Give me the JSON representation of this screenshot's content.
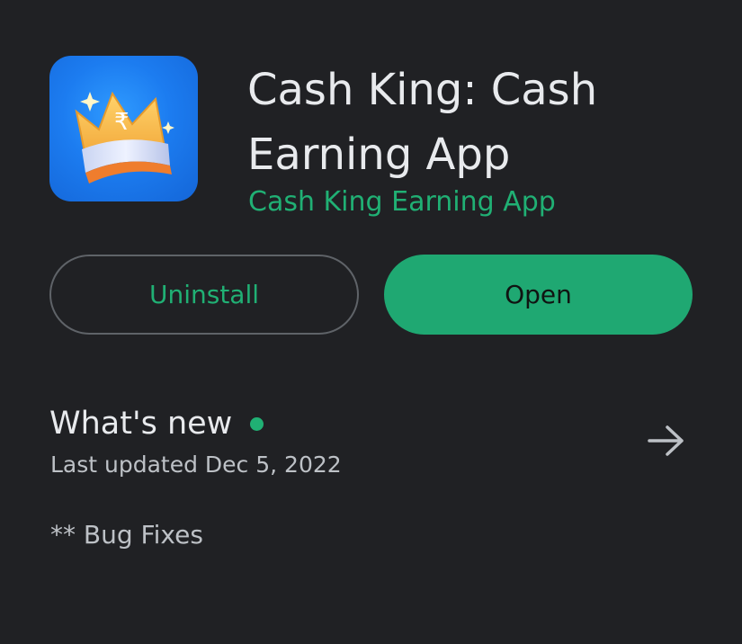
{
  "app": {
    "title": "Cash King: Cash Earning App",
    "developer": "Cash King Earning App",
    "icon": "crown-icon"
  },
  "actions": {
    "uninstall_label": "Uninstall",
    "open_label": "Open"
  },
  "whats_new": {
    "heading": "What's new",
    "last_updated": "Last updated Dec 5, 2022",
    "notes": "** Bug Fixes",
    "arrow_icon": "arrow-right-icon"
  },
  "colors": {
    "background": "#202124",
    "accent": "#1fa872",
    "text": "#e8eaed"
  }
}
